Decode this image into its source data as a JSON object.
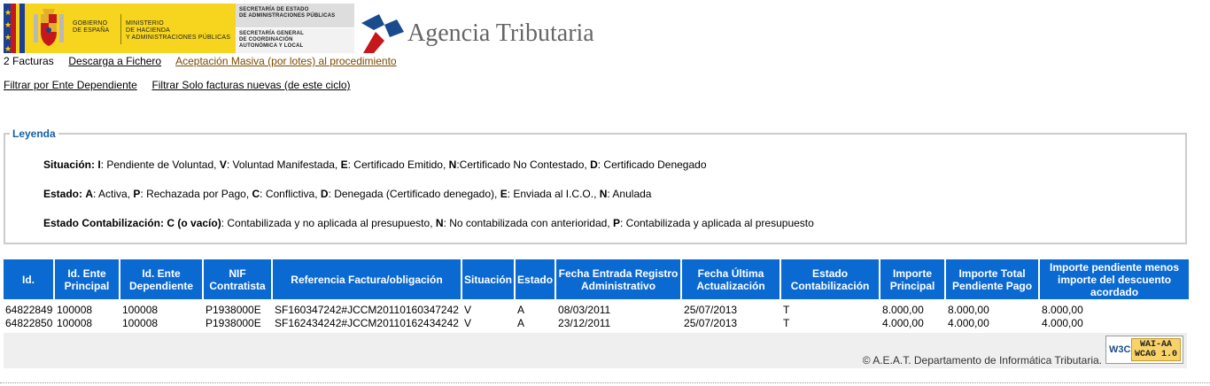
{
  "header": {
    "gov_text": [
      "GOBIERNO",
      "DE ESPAÑA"
    ],
    "ministry_text": [
      "MINISTERIO",
      "DE HACIENDA",
      "Y ADMINISTRACIONES PÚBLICAS"
    ],
    "secretaria1": [
      "SECRETARÍA DE ESTADO",
      "DE ADMINISTRACIONES PÚBLICAS"
    ],
    "secretaria2": [
      "SECRETARÍA GENERAL",
      "DE COORDINACIÓN",
      "AUTONÓMICA Y LOCAL"
    ],
    "agency_name": "Agencia Tributaria"
  },
  "toolbar": {
    "count_label": "2 Facturas",
    "download_link": "Descarga a Fichero",
    "bulk_accept_link": "Aceptación Masiva (por lotes) al procedimiento",
    "filter_dependent_link": "Filtrar por Ente Dependiente",
    "filter_new_link": "Filtrar Solo facturas nuevas (de este ciclo)"
  },
  "legend": {
    "title": "Leyenda",
    "situacion": {
      "label": "Situación:",
      "items": [
        {
          "code": "I",
          "text": ": Pendiente de Voluntad, "
        },
        {
          "code": "V",
          "text": ": Voluntad Manifestada, "
        },
        {
          "code": "E",
          "text": ": Certificado Emitido, "
        },
        {
          "code": "N",
          "text": ":Certificado No Contestado, "
        },
        {
          "code": "D",
          "text": ": Certificado Denegado"
        }
      ]
    },
    "estado": {
      "label": "Estado:",
      "items": [
        {
          "code": "A",
          "text": ": Activa, "
        },
        {
          "code": "P",
          "text": ": Rechazada por Pago, "
        },
        {
          "code": "C",
          "text": ": Conflictiva, "
        },
        {
          "code": "D",
          "text": ": Denegada (Certificado denegado), "
        },
        {
          "code": "E",
          "text": ": Enviada al I.C.O., "
        },
        {
          "code": "N",
          "text": ": Anulada"
        }
      ]
    },
    "contabilizacion": {
      "label": "Estado Contabilización:",
      "items": [
        {
          "code": "C (o vacío)",
          "text": ": Contabilizada y no aplicada al presupuesto, "
        },
        {
          "code": "N",
          "text": ": No contabilizada con anterioridad, "
        },
        {
          "code": "P",
          "text": ": Contabilizada y aplicada al presupuesto"
        }
      ]
    }
  },
  "table": {
    "headers": [
      "Id.",
      "Id. Ente Principal",
      "Id. Ente Dependiente",
      "NIF Contratista",
      "Referencia Factura/obligación",
      "Situación",
      "Estado",
      "Fecha Entrada Registro Administrativo",
      "Fecha Última Actualización",
      "Estado Contabilización",
      "Importe Principal",
      "Importe Total Pendiente Pago",
      "Importe pendiente menos importe del descuento acordado"
    ],
    "rows": [
      [
        "64822849",
        "100008",
        "100008",
        "P1938000E",
        "SF160347242#JCCM20110160347242",
        "V",
        "A",
        "08/03/2011",
        "25/07/2013",
        "T",
        "8.000,00",
        "8.000,00",
        "8.000,00"
      ],
      [
        "64822850",
        "100008",
        "100008",
        "P1938000E",
        "SF162434242#JCCM20110162434242",
        "V",
        "A",
        "23/12/2011",
        "25/07/2013",
        "T",
        "4.000,00",
        "4.000,00",
        "4.000,00"
      ]
    ]
  },
  "footer": {
    "copyright": "© A.E.A.T. Departamento de Informática Tributaria.",
    "badge_left": "W3C",
    "badge_right": [
      "WAI-AA",
      "WCAG 1.0"
    ]
  },
  "colors": {
    "header_blue": "#0a6ad1",
    "legend_title": "#1760a8",
    "gov_yellow": "#f7d51e"
  }
}
